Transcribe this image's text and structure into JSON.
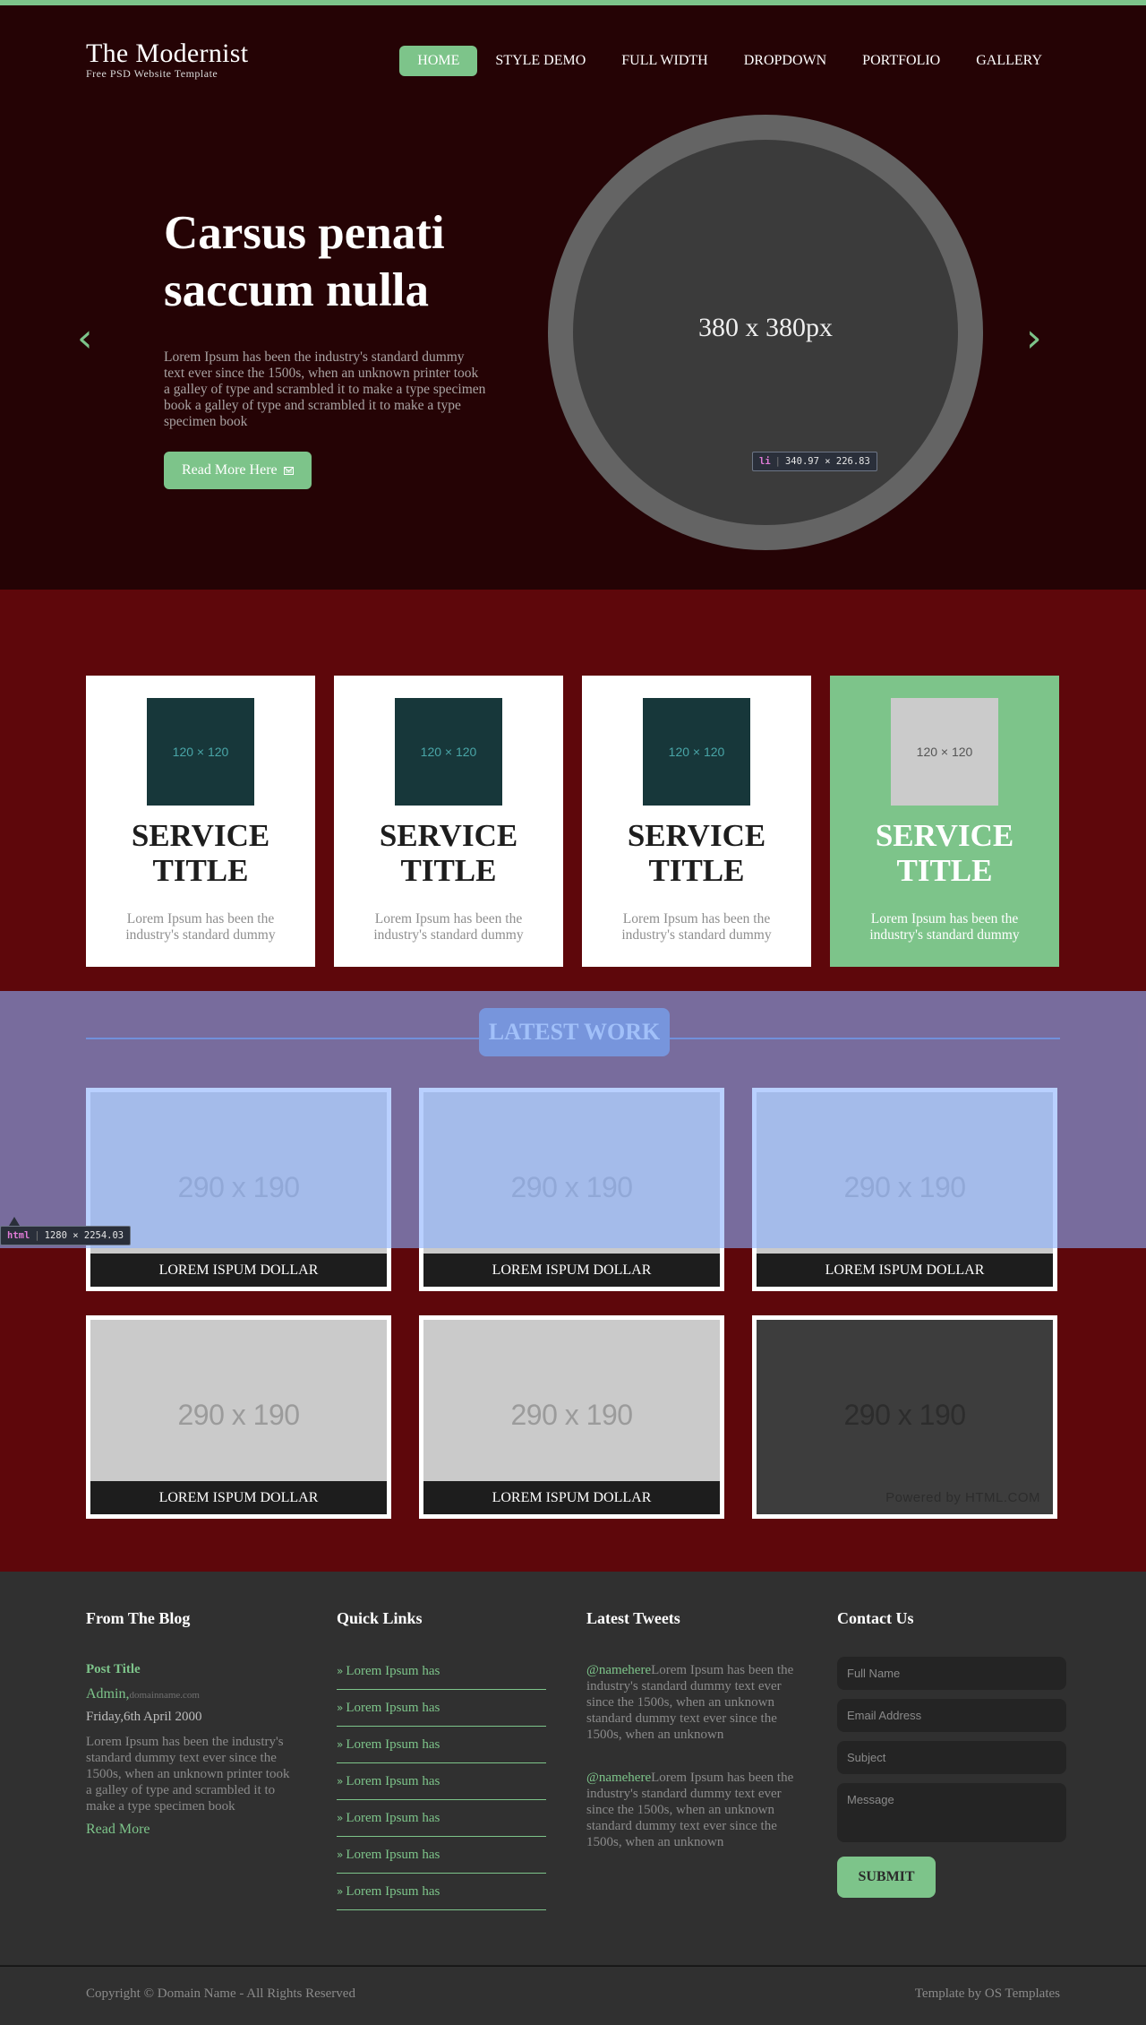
{
  "brand": {
    "name": "The Modernist",
    "tagline": "Free PSD Website Template"
  },
  "nav": {
    "items": [
      {
        "label": "HOME"
      },
      {
        "label": "STYLE DEMO"
      },
      {
        "label": "FULL WIDTH"
      },
      {
        "label": "DROPDOWN"
      },
      {
        "label": "PORTFOLIO"
      },
      {
        "label": "GALLERY"
      }
    ],
    "active": "HOME"
  },
  "hero": {
    "title": "Carsus penati saccum nulla",
    "body": "Lorem Ipsum has been the industry's standard dummy text ever since the 1500s, when an unknown printer took a galley of type and scrambled it to make a type specimen book a galley of type and scrambled it to make a type specimen book",
    "button_label": "Read More Here",
    "button_icon": "envelope-icon",
    "image_label": "380 x 380px",
    "prev_icon": "‹",
    "next_icon": "›"
  },
  "devtools": {
    "li_tag": "li",
    "li_size": "340.97 × 226.83",
    "html_tag": "html",
    "html_size": "1280 × 2254.03"
  },
  "services": [
    {
      "image_label": "120 × 120",
      "title": "SERVICE TITLE",
      "desc": "Lorem Ipsum has been the industry's standard dummy",
      "featured": false
    },
    {
      "image_label": "120 × 120",
      "title": "SERVICE TITLE",
      "desc": "Lorem Ipsum has been the industry's standard dummy",
      "featured": false
    },
    {
      "image_label": "120 × 120",
      "title": "SERVICE TITLE",
      "desc": "Lorem Ipsum has been the industry's standard dummy",
      "featured": false
    },
    {
      "image_label": "120 × 120",
      "title": "SERVICE TITLE",
      "desc": "Lorem Ipsum has been the industry's standard dummy",
      "featured": true
    }
  ],
  "work": {
    "heading": "LATEST WORK",
    "items": [
      {
        "image_label": "290 x 190",
        "caption": "LOREM ISPUM DOLLAR"
      },
      {
        "image_label": "290 x 190",
        "caption": "LOREM ISPUM DOLLAR"
      },
      {
        "image_label": "290 x 190",
        "caption": "LOREM ISPUM DOLLAR"
      },
      {
        "image_label": "290 x 190",
        "caption": "LOREM ISPUM DOLLAR"
      },
      {
        "image_label": "290 x 190",
        "caption": "LOREM ISPUM DOLLAR"
      },
      {
        "image_label": "290 x 190",
        "caption": ""
      }
    ],
    "powered": "Powered by HTML.COM"
  },
  "footer": {
    "blog": {
      "title": "From The Blog",
      "post_title": "Post Title",
      "author": "Admin,",
      "domain": "domainname.com",
      "date": "Friday,6th April 2000",
      "body": "Lorem Ipsum has been the industry's standard dummy text ever since the 1500s, when an unknown printer took a galley of type and scrambled it to make a type specimen book",
      "more": "Read More"
    },
    "quick_links": {
      "title": "Quick Links",
      "items": [
        "Lorem Ipsum has",
        "Lorem Ipsum has",
        "Lorem Ipsum has",
        "Lorem Ipsum has",
        "Lorem Ipsum has",
        "Lorem Ipsum has",
        "Lorem Ipsum has"
      ]
    },
    "tweets": {
      "title": "Latest Tweets",
      "items": [
        {
          "handle": "@namehere",
          "text": "Lorem Ipsum has been the industry's standard dummy text ever since the 1500s, when an unknown standard dummy text ever since the 1500s, when an unknown"
        },
        {
          "handle": "@namehere",
          "text": "Lorem Ipsum has been the industry's standard dummy text ever since the 1500s, when an unknown standard dummy text ever since the 1500s, when an unknown"
        }
      ]
    },
    "contact": {
      "title": "Contact Us",
      "full_name_placeholder": "Full Name",
      "email_placeholder": "Email Address",
      "subject_placeholder": "Subject",
      "message_placeholder": "Message",
      "submit_label": "SUBMIT"
    }
  },
  "bottom": {
    "copyright": "Copyright © Domain Name - All Rights Reserved",
    "credit": "Template by OS Templates"
  },
  "colors": {
    "accent": "#7dc48a",
    "hero_bg": "#250305",
    "section_bg": "#5e070b",
    "footer_bg": "#303030"
  }
}
